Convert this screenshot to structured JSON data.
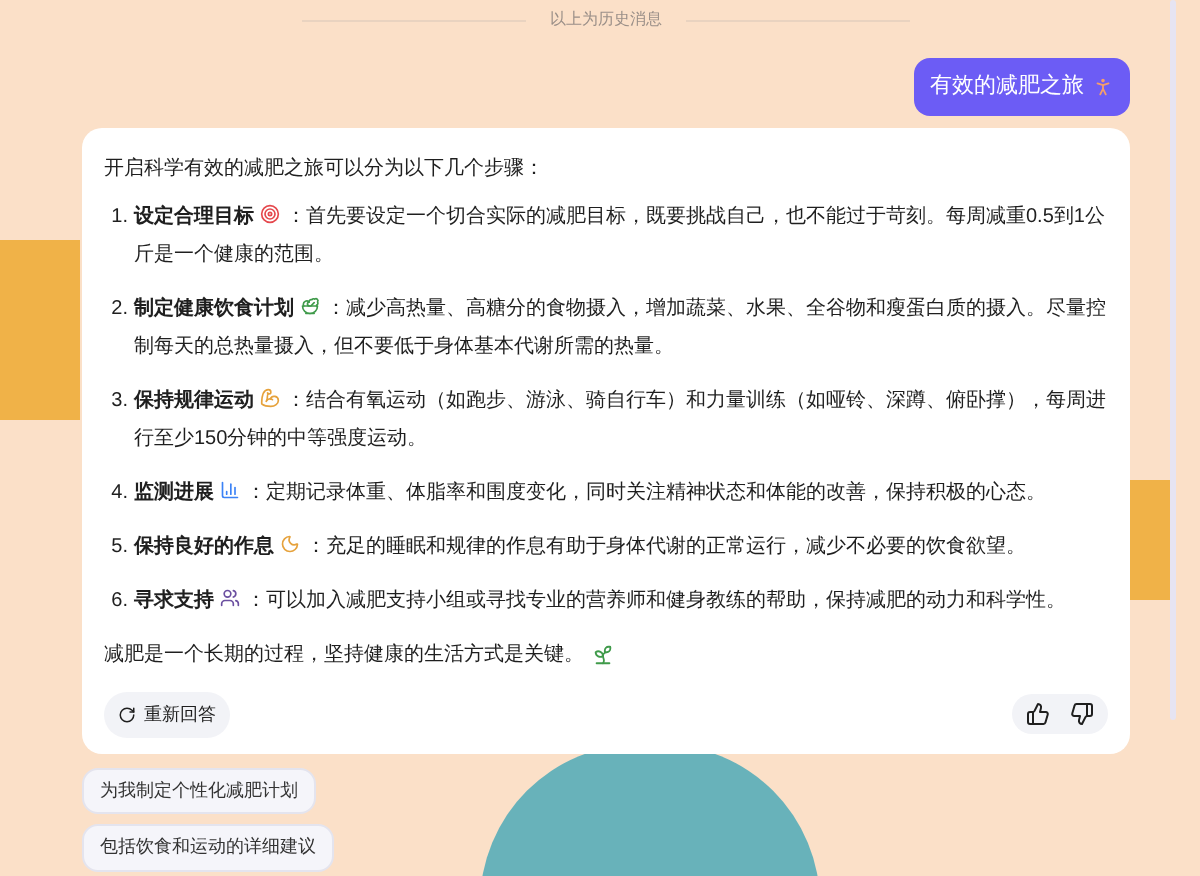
{
  "history_divider": "以上为历史消息",
  "user_message": {
    "text": "有效的减肥之旅"
  },
  "answer": {
    "intro": "开启科学有效的减肥之旅可以分为以下几个步骤：",
    "steps": [
      {
        "number": "1.",
        "title": "设定合理目标",
        "text": "：首先要设定一个切合实际的减肥目标，既要挑战自己，也不能过于苛刻。每周减重0.5到1公斤是一个健康的范围。"
      },
      {
        "number": "2.",
        "title": "制定健康饮食计划",
        "text": "：减少高热量、高糖分的食物摄入，增加蔬菜、水果、全谷物和瘦蛋白质的摄入。尽量控制每天的总热量摄入，但不要低于身体基本代谢所需的热量。"
      },
      {
        "number": "3.",
        "title": "保持规律运动",
        "text": "：结合有氧运动（如跑步、游泳、骑自行车）和力量训练（如哑铃、深蹲、俯卧撑），每周进行至少150分钟的中等强度运动。"
      },
      {
        "number": "4.",
        "title": "监测进展",
        "text": "：定期记录体重、体脂率和围度变化，同时关注精神状态和体能的改善，保持积极的心态。"
      },
      {
        "number": "5.",
        "title": "保持良好的作息",
        "text": "：充足的睡眠和规律的作息有助于身体代谢的正常运行，减少不必要的饮食欲望。"
      },
      {
        "number": "6.",
        "title": "寻求支持",
        "text": "：可以加入减肥支持小组或寻找专业的营养师和健身教练的帮助，保持减肥的动力和科学性。"
      }
    ],
    "conclusion": "减肥是一个长期的过程，坚持健康的生活方式是关键。",
    "regenerate_label": "重新回答"
  },
  "suggestions": [
    "为我制定个性化减肥计划",
    "包括饮食和运动的详细建议"
  ]
}
